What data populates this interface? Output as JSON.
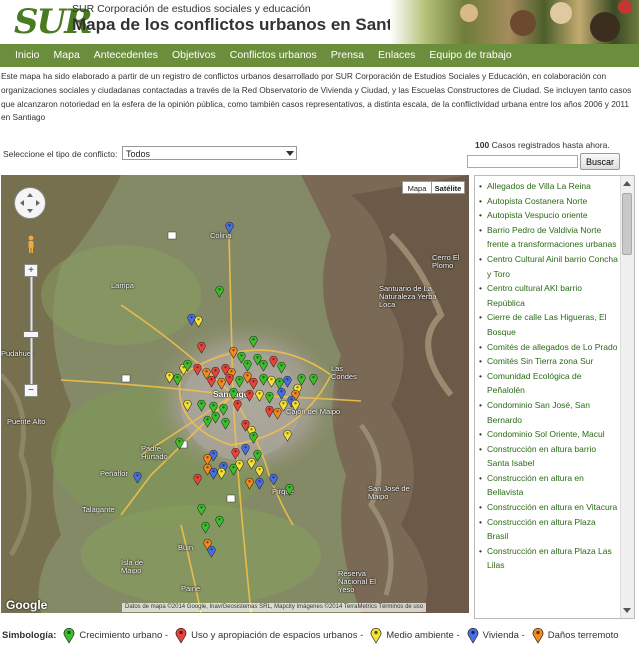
{
  "header": {
    "logo": "SUR",
    "org_name": "SUR Corporación de estudios sociales y educación",
    "title": "Mapa de los conflictos urbanos en Santiago"
  },
  "nav": {
    "items": [
      "Inicio",
      "Mapa",
      "Antecedentes",
      "Objetivos",
      "Conflictos urbanos",
      "Prensa",
      "Enlaces",
      "Equipo de trabajo"
    ]
  },
  "intro": "Este mapa ha sido elaborado a partir de un registro de conflictos urbanos desarrollado por SUR Corporación de Estudios Sociales y Educación, en colaboración con organizaciones sociales y ciudadanas contactadas a través de la Red Observatorio de Vivienda y Ciudad, y las Escuelas Constructores de Ciudad. Se incluyen tanto casos que alcanzaron notoriedad en la esfera de la opinión pública, como también casos representativos, a distinta escala, de la conflictividad urbana entre los años 2006 y 2011 en Santiago",
  "filter": {
    "label": "Seleccione el tipo de conflicto:",
    "selected": "Todos"
  },
  "summary": {
    "count": "100",
    "count_text": "Casos registrados hasta ahora."
  },
  "search": {
    "value": "",
    "button": "Buscar"
  },
  "map": {
    "type_buttons": {
      "map": "Mapa",
      "satellite": "Satélite"
    },
    "google": "Google",
    "attribution": "Datos de mapa ©2014 Google, Inav/Geosistemas SRL, Mapcity Imágenes ©2014 TerraMetrics     Términos de uso",
    "places": [
      "Colina",
      "Lampa",
      "Cerro El Plomo",
      "Santuario de La Naturaleza Yerba Loca",
      "Santiago",
      "Padre Hurtado",
      "Peñaflor",
      "Talagante",
      "Pirque",
      "San José de Maipo",
      "Buin",
      "Reserva Nacional El Yeso",
      "Paine",
      "Isla de Maipo",
      "Las Condes",
      "Pudahuel",
      "Puente Alto",
      "Cajón del Maipo"
    ],
    "colors": {
      "green": "#3cbf2c",
      "red": "#e8443a",
      "yellow": "#f2e13a",
      "blue": "#4a6fe0",
      "orange": "#f28a1e"
    }
  },
  "cases": [
    "Allegados de Villa La Reina",
    "Autopista Costanera Norte",
    "Autopista Vespucio oriente",
    "Barrio Pedro de Valdivia Norte frente a transformaciones urbanas",
    "Centro Cultural Ainil barrio Concha y Toro",
    "Centro cultural AKI barrio República",
    "Cierre de calle Las Higueras, El Bosque",
    "Comités de allegados de Lo Prado",
    "Comités Sin Tierra zona Sur",
    "Comunidad Ecológica de Peñalolén",
    "Condominio San José, San Bernardo",
    "Condominio Sol Oriente, Macul",
    "Construcción en altura barrio Santa Isabel",
    "Construcción en altura en Bellavista",
    "Construcción en altura en Vitacura",
    "Construcción en altura Plaza Brasil",
    "Construcción en altura Plaza Las Lilas"
  ],
  "legend": {
    "label": "Simbología:",
    "items": [
      {
        "label": "Crecimiento urbano -",
        "color": "#3cbf2c",
        "icon": "green-marker-icon"
      },
      {
        "label": "Uso y apropiación de espacios urbanos -",
        "color": "#e8443a",
        "icon": "red-marker-icon"
      },
      {
        "label": "Medio ambiente -",
        "color": "#f2e13a",
        "icon": "yellow-marker-icon"
      },
      {
        "label": "Vivienda -",
        "color": "#4a6fe0",
        "icon": "blue-marker-icon"
      },
      {
        "label": "Daños terremoto",
        "color": "#f28a1e",
        "icon": "orange-marker-icon"
      }
    ]
  }
}
